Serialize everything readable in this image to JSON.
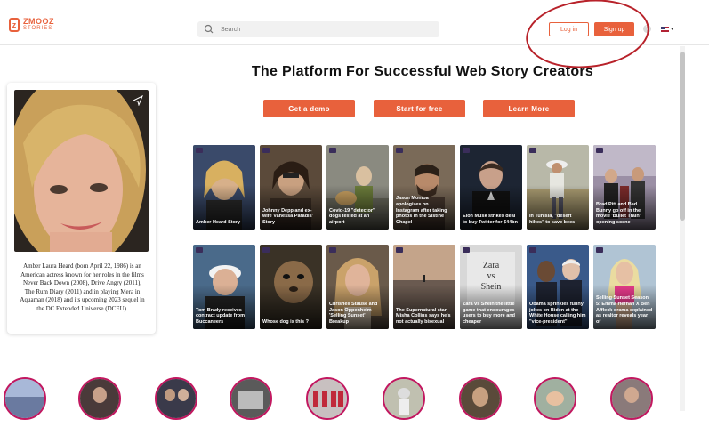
{
  "header": {
    "logo_text": "ZMOOZ",
    "logo_sub": "STORIES",
    "search_placeholder": "Search",
    "login_label": "Log in",
    "signup_label": "Sign up",
    "help_label": "?",
    "language_caret": "▾"
  },
  "hero": {
    "title": "The Platform For Successful Web Story Creators",
    "buttons": [
      "Get a demo",
      "Start for free",
      "Learn More"
    ]
  },
  "featured": {
    "text": "Amber Laura Heard (born April 22, 1986) is an American actress known for her roles in the films Never Back Down (2008), Drive Angry (2011), The Rum Diary (2011) and in playing Mera in Aquaman (2018) and its upcoming 2023 sequel in the DC Extended Universe (DCEU)."
  },
  "stories": [
    {
      "caption": "Amber Heard Story"
    },
    {
      "caption": "Johnny Depp and ex-wife Vanessa Paradis' Story"
    },
    {
      "caption": "Covid-19 \"detector\" dogs tested at an airport"
    },
    {
      "caption": "Jason Momoa apologizes on Instagram after taking photos in the Sistine Chapel"
    },
    {
      "caption": "Elon Musk strikes deal to buy Twitter for $44bn"
    },
    {
      "caption": "In Tunisia, \"desert hikes\" to save bees"
    },
    {
      "caption": "Brad Pitt and Bad Bunny go off in the movie 'Bullet Train' opening scene"
    },
    {
      "caption": "Tom Brady receives contract update from Buccaneers"
    },
    {
      "caption": "Whose dog is this ?"
    },
    {
      "caption": "Chrishell Stause and Jason Oppenheim 'Selling Sunset' Breakup"
    },
    {
      "caption": "The Supernatural star Misha Collins says he's not actually bisexual"
    },
    {
      "caption": "Zara vs Shein the little game that encourages users to buy more and cheaper"
    },
    {
      "caption": "Obama sprinkles funny jokes on Biden at the White House calling him \"vice-president\""
    },
    {
      "caption": "Selling Sunset Season 5: Emma Hernan X Ben Affleck drama explained as realtor reveals year of"
    }
  ],
  "card_overlay_texts": {
    "zara_vs_shein": "Zara\nvs\nShein"
  },
  "colors": {
    "accent": "#e8613c",
    "annotation": "#b8222a",
    "bubble_ring": "#c21860"
  }
}
